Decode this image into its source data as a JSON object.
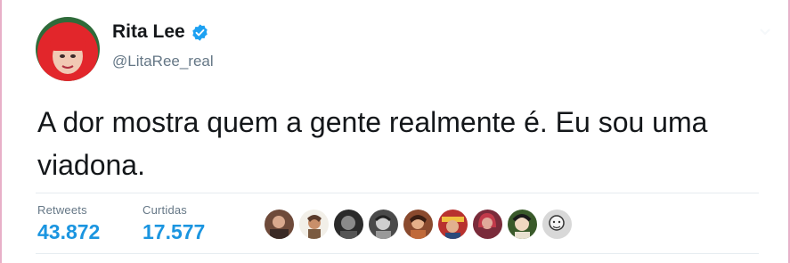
{
  "user": {
    "display_name": "Rita Lee",
    "handle": "@LitaRee_real",
    "verified": true,
    "avatar_icon": "profile-photo-red-hair"
  },
  "tweet": {
    "text": "A dor mostra quem a gente realmente é. Eu sou uma viadona."
  },
  "stats": {
    "retweets_label": "Retweets",
    "retweets_value": "43.872",
    "likes_label": "Curtidas",
    "likes_value": "17.577"
  },
  "likers": {
    "count_shown": 9,
    "icon": "liker-avatar-icon"
  },
  "colors": {
    "link_blue": "#1b95e0",
    "secondary_text": "#657786",
    "divider": "#e6ecf0",
    "verified_badge": "#1da1f2"
  }
}
